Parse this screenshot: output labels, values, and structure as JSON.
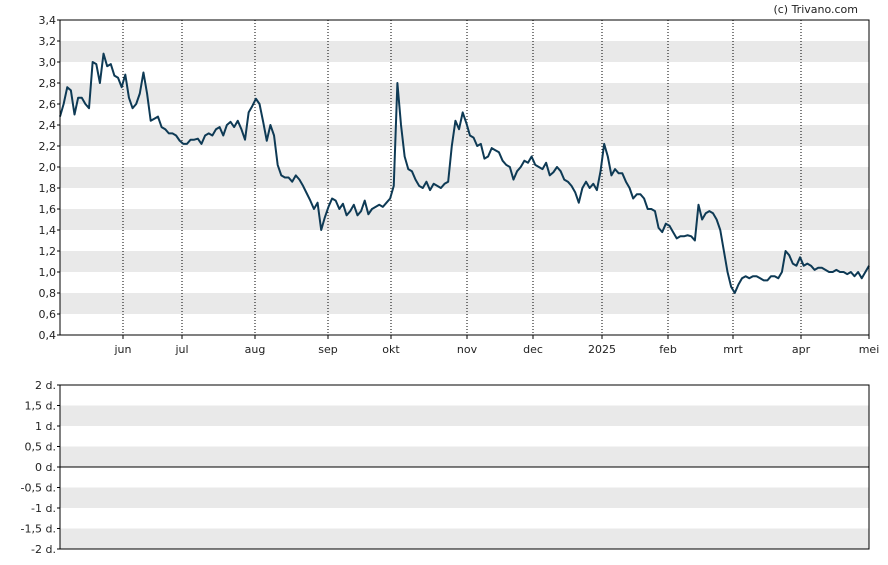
{
  "credit": "(c) Trivano.com",
  "colors": {
    "line": "#0e3a55",
    "stripe": "#e9e9e9",
    "background": "#ffffff",
    "axis": "#000000",
    "vgrid": "#000000"
  },
  "chart_data": [
    {
      "type": "line",
      "title": "",
      "xlabel": "",
      "ylabel": "",
      "ylim": [
        0.4,
        3.4
      ],
      "yticks": [
        "3,4",
        "3,2",
        "3,0",
        "2,8",
        "2,6",
        "2,4",
        "2,2",
        "2,0",
        "1,8",
        "1,6",
        "1,4",
        "1,2",
        "1,0",
        "0,8",
        "0,6",
        "0,4"
      ],
      "xticks": [
        "jun",
        "jul",
        "aug",
        "sep",
        "okt",
        "nov",
        "dec",
        "2025",
        "feb",
        "mrt",
        "apr",
        "mei"
      ],
      "grid": "horizontal stripes, dotted vertical lines at month ticks",
      "series": [
        {
          "values": [
            2.48,
            2.6,
            2.76,
            2.73,
            2.5,
            2.66,
            2.66,
            2.6,
            2.56,
            3.0,
            2.98,
            2.8,
            3.08,
            2.96,
            2.98,
            2.87,
            2.85,
            2.76,
            2.88,
            2.66,
            2.56,
            2.6,
            2.7,
            2.9,
            2.7,
            2.44,
            2.46,
            2.48,
            2.38,
            2.36,
            2.32,
            2.32,
            2.3,
            2.25,
            2.22,
            2.22,
            2.26,
            2.26,
            2.27,
            2.22,
            2.3,
            2.32,
            2.3,
            2.36,
            2.38,
            2.3,
            2.4,
            2.43,
            2.38,
            2.44,
            2.36,
            2.26,
            2.52,
            2.58,
            2.65,
            2.6,
            2.43,
            2.25,
            2.4,
            2.3,
            2.02,
            1.92,
            1.9,
            1.9,
            1.86,
            1.92,
            1.88,
            1.82,
            1.75,
            1.68,
            1.6,
            1.66,
            1.4,
            1.52,
            1.62,
            1.7,
            1.68,
            1.6,
            1.65,
            1.54,
            1.58,
            1.64,
            1.54,
            1.58,
            1.68,
            1.55,
            1.6,
            1.62,
            1.64,
            1.62,
            1.66,
            1.7,
            1.82,
            2.8,
            2.4,
            2.1,
            1.98,
            1.96,
            1.88,
            1.82,
            1.8,
            1.86,
            1.78,
            1.84,
            1.82,
            1.8,
            1.84,
            1.86,
            2.2,
            2.44,
            2.36,
            2.52,
            2.42,
            2.3,
            2.28,
            2.2,
            2.22,
            2.08,
            2.1,
            2.18,
            2.16,
            2.14,
            2.06,
            2.02,
            2.0,
            1.88,
            1.96,
            2.0,
            2.06,
            2.04,
            2.1,
            2.02,
            2.0,
            1.98,
            2.04,
            1.92,
            1.95,
            2.0,
            1.96,
            1.88,
            1.86,
            1.82,
            1.76,
            1.66,
            1.8,
            1.86,
            1.8,
            1.84,
            1.78,
            1.96,
            2.22,
            2.1,
            1.92,
            1.98,
            1.94,
            1.94,
            1.86,
            1.8,
            1.7,
            1.74,
            1.74,
            1.7,
            1.6,
            1.6,
            1.58,
            1.42,
            1.38,
            1.46,
            1.44,
            1.38,
            1.32,
            1.34,
            1.34,
            1.35,
            1.34,
            1.3,
            1.64,
            1.5,
            1.56,
            1.58,
            1.56,
            1.5,
            1.4,
            1.2,
            1.0,
            0.86,
            0.8,
            0.88,
            0.94,
            0.96,
            0.94,
            0.96,
            0.96,
            0.94,
            0.92,
            0.92,
            0.96,
            0.96,
            0.94,
            1.0,
            1.2,
            1.16,
            1.08,
            1.06,
            1.14,
            1.06,
            1.08,
            1.06,
            1.02,
            1.04,
            1.04,
            1.02,
            1.0,
            1.0,
            1.02,
            1.0,
            1.0,
            0.98,
            1.0,
            0.96,
            1.0,
            0.94,
            1.0,
            1.06
          ]
        }
      ]
    },
    {
      "type": "line",
      "title": "",
      "xlabel": "",
      "ylabel": "",
      "ylim": [
        -2,
        2
      ],
      "yticks": [
        "2 d.",
        "1,5 d.",
        "1 d.",
        "0,5 d.",
        "0 d.",
        "-0,5 d.",
        "-1 d.",
        "-1,5 d.",
        "-2 d."
      ],
      "grid": "horizontal stripes",
      "baseline": 0,
      "series": []
    }
  ]
}
